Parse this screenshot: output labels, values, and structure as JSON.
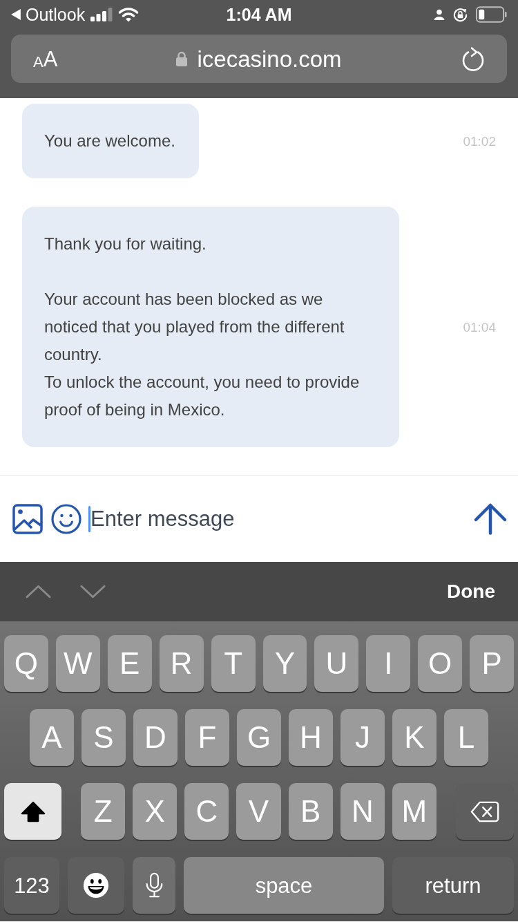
{
  "status_bar": {
    "back_label": "Outlook",
    "time": "1:04 AM"
  },
  "address_bar": {
    "text_size_small": "A",
    "text_size_large": "A",
    "secure": true,
    "url": "icecasino.com"
  },
  "messages": [
    {
      "text": "You are welcome.",
      "time": "01:02"
    },
    {
      "text": "Thank you for waiting.\n\nYour account has been blocked as we noticed that you played from the different country.\nTo unlock the account, you need to provide proof of being in Mexico.",
      "time": "01:04"
    }
  ],
  "composer": {
    "placeholder": "Enter message",
    "focused": true
  },
  "keyboard_toolbar": {
    "nav": [
      {
        "kind": "previous",
        "disabled": true
      },
      {
        "kind": "next",
        "disabled": true
      }
    ],
    "done_label": "Done"
  },
  "keyboard": {
    "rows": [
      {
        "keys": [
          {
            "kind": "letter",
            "label": "Q"
          },
          {
            "kind": "letter",
            "label": "W"
          },
          {
            "kind": "letter",
            "label": "E"
          },
          {
            "kind": "letter",
            "label": "R"
          },
          {
            "kind": "letter",
            "label": "T"
          },
          {
            "kind": "letter",
            "label": "Y"
          },
          {
            "kind": "letter",
            "label": "U"
          },
          {
            "kind": "letter",
            "label": "I"
          },
          {
            "kind": "letter",
            "label": "O"
          },
          {
            "kind": "letter",
            "label": "P"
          }
        ]
      },
      {
        "keys": [
          {
            "kind": "letter",
            "label": "A"
          },
          {
            "kind": "letter",
            "label": "S"
          },
          {
            "kind": "letter",
            "label": "D"
          },
          {
            "kind": "letter",
            "label": "F"
          },
          {
            "kind": "letter",
            "label": "G"
          },
          {
            "kind": "letter",
            "label": "H"
          },
          {
            "kind": "letter",
            "label": "J"
          },
          {
            "kind": "letter",
            "label": "K"
          },
          {
            "kind": "letter",
            "label": "L"
          }
        ]
      },
      {
        "keys": [
          {
            "kind": "shift",
            "on": true
          },
          {
            "kind": "letter",
            "label": "Z"
          },
          {
            "kind": "letter",
            "label": "X"
          },
          {
            "kind": "letter",
            "label": "C"
          },
          {
            "kind": "letter",
            "label": "V"
          },
          {
            "kind": "letter",
            "label": "B"
          },
          {
            "kind": "letter",
            "label": "N"
          },
          {
            "kind": "letter",
            "label": "M"
          },
          {
            "kind": "delete"
          }
        ]
      },
      {
        "keys": [
          {
            "kind": "mode",
            "label": "123"
          },
          {
            "kind": "emoji"
          },
          {
            "kind": "dictation"
          },
          {
            "kind": "space",
            "label": "space"
          },
          {
            "kind": "return",
            "label": "return"
          }
        ]
      }
    ]
  }
}
